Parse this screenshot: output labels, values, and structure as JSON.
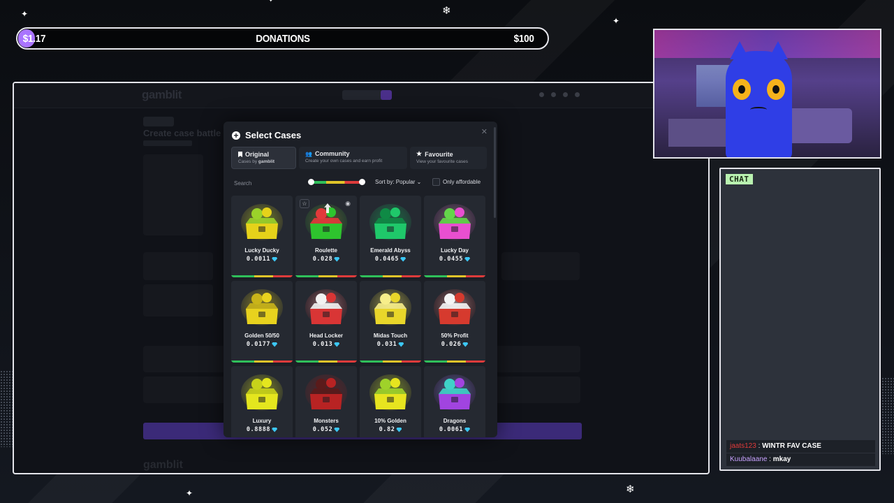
{
  "donation": {
    "current": "$1.17",
    "title": "DONATIONS",
    "goal": "$100",
    "progress": 0.0117,
    "fill_color": "#a974ff"
  },
  "game": {
    "logo": "gamblit",
    "page_title": "Create case battle"
  },
  "modal": {
    "title": "Select Cases",
    "tabs": [
      {
        "label": "Original",
        "desc_prefix": "Cases by",
        "desc_brand": "gamblit",
        "icon": "bookmark-icon",
        "active": true
      },
      {
        "label": "Community",
        "desc": "Create your own cases and earn profit",
        "icon": "users-icon",
        "active": false
      },
      {
        "label": "Favourite",
        "desc": "View your favourite cases",
        "icon": "star-icon",
        "active": false
      }
    ],
    "search_placeholder": "Search",
    "sort_label": "Sort by: Popular",
    "only_affordable_label": "Only affordable",
    "cases": [
      {
        "name": "Lucky Ducky",
        "price": "0.0011",
        "color": "#e6d21a",
        "accent": "#9bd22a"
      },
      {
        "name": "Roulette",
        "price": "0.028",
        "color": "#2ec42e",
        "accent": "#e23a3a"
      },
      {
        "name": "Emerald Abyss",
        "price": "0.0465",
        "color": "#1fc86a",
        "accent": "#0f8a45"
      },
      {
        "name": "Lucky Day",
        "price": "0.0455",
        "color": "#e94fd0",
        "accent": "#64d64a"
      },
      {
        "name": "Golden 50/50",
        "price": "0.0177",
        "color": "#e8d21e",
        "accent": "#c9b419"
      },
      {
        "name": "Head Locker",
        "price": "0.013",
        "color": "#d93535",
        "accent": "#f2f2f2"
      },
      {
        "name": "Midas Touch",
        "price": "0.031",
        "color": "#e9d62a",
        "accent": "#f7ee8a"
      },
      {
        "name": "50% Profit",
        "price": "0.026",
        "color": "#d63a2e",
        "accent": "#f4f4f4"
      },
      {
        "name": "Luxury",
        "price": "0.8888",
        "color": "#e4e61e",
        "accent": "#c8d21a"
      },
      {
        "name": "Monsters",
        "price": "0.052",
        "color": "#b82323",
        "accent": "#5a1b1b"
      },
      {
        "name": "10% Golden",
        "price": "0.82",
        "color": "#e7e41f",
        "accent": "#9fd22a"
      },
      {
        "name": "Dragons",
        "price": "0.0061",
        "color": "#a144e0",
        "accent": "#3fd1c8"
      }
    ]
  },
  "chat": {
    "label": "CHAT",
    "messages": [
      {
        "user": "jaats123",
        "user_color": "#e23a3a",
        "text": "WINTR FAV CASE"
      },
      {
        "user": "Kuubalaane",
        "user_color": "#c8a2ff",
        "text": "mkay"
      }
    ]
  },
  "colors": {
    "rarity_green": "#2fbf5a",
    "rarity_yellow": "#e0c429",
    "rarity_red": "#dd3b3b",
    "diamond": "#3cc7f5"
  }
}
